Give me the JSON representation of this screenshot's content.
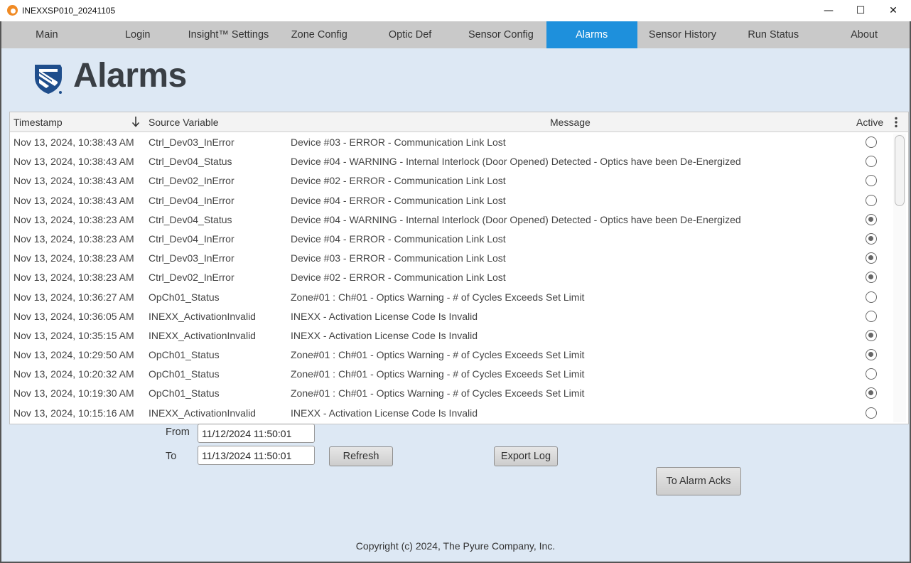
{
  "window": {
    "title": "INEXXSP010_20241105",
    "minimize": "—",
    "maximize": "☐",
    "close": "✕"
  },
  "tabs": [
    {
      "label": "Main"
    },
    {
      "label": "Login"
    },
    {
      "label": "Insight™ Settings"
    },
    {
      "label": "Zone Config"
    },
    {
      "label": "Optic Def"
    },
    {
      "label": "Sensor Config"
    },
    {
      "label": "Alarms",
      "active": true
    },
    {
      "label": "Sensor History"
    },
    {
      "label": "Run Status"
    },
    {
      "label": "About"
    }
  ],
  "page": {
    "title": "Alarms"
  },
  "table": {
    "columns": {
      "timestamp": "Timestamp",
      "source": "Source Variable",
      "message": "Message",
      "active": "Active"
    },
    "rows": [
      {
        "timestamp": "Nov 13, 2024, 10:38:43 AM",
        "source": "Ctrl_Dev03_InError",
        "message": "Device #03 - ERROR - Communication Link Lost",
        "active": false
      },
      {
        "timestamp": "Nov 13, 2024, 10:38:43 AM",
        "source": "Ctrl_Dev04_Status",
        "message": "Device #04 - WARNING - Internal Interlock (Door Opened) Detected - Optics have been De-Energized",
        "active": false
      },
      {
        "timestamp": "Nov 13, 2024, 10:38:43 AM",
        "source": "Ctrl_Dev02_InError",
        "message": "Device #02 - ERROR - Communication Link Lost",
        "active": false
      },
      {
        "timestamp": "Nov 13, 2024, 10:38:43 AM",
        "source": "Ctrl_Dev04_InError",
        "message": "Device #04 - ERROR - Communication Link Lost",
        "active": false
      },
      {
        "timestamp": "Nov 13, 2024, 10:38:23 AM",
        "source": "Ctrl_Dev04_Status",
        "message": "Device #04 - WARNING - Internal Interlock (Door Opened) Detected - Optics have been De-Energized",
        "active": true
      },
      {
        "timestamp": "Nov 13, 2024, 10:38:23 AM",
        "source": "Ctrl_Dev04_InError",
        "message": "Device #04 - ERROR - Communication Link Lost",
        "active": true
      },
      {
        "timestamp": "Nov 13, 2024, 10:38:23 AM",
        "source": "Ctrl_Dev03_InError",
        "message": "Device #03 - ERROR - Communication Link Lost",
        "active": true
      },
      {
        "timestamp": "Nov 13, 2024, 10:38:23 AM",
        "source": "Ctrl_Dev02_InError",
        "message": "Device #02 - ERROR - Communication Link Lost",
        "active": true
      },
      {
        "timestamp": "Nov 13, 2024, 10:36:27 AM",
        "source": "OpCh01_Status",
        "message": "Zone#01 : Ch#01 - Optics Warning - # of Cycles Exceeds Set Limit",
        "active": false
      },
      {
        "timestamp": "Nov 13, 2024, 10:36:05 AM",
        "source": "INEXX_ActivationInvalid",
        "message": "INEXX - Activation License Code Is Invalid",
        "active": false
      },
      {
        "timestamp": "Nov 13, 2024, 10:35:15 AM",
        "source": "INEXX_ActivationInvalid",
        "message": "INEXX - Activation License Code Is Invalid",
        "active": true
      },
      {
        "timestamp": "Nov 13, 2024, 10:29:50 AM",
        "source": "OpCh01_Status",
        "message": "Zone#01 : Ch#01 - Optics Warning - # of Cycles Exceeds Set Limit",
        "active": true
      },
      {
        "timestamp": "Nov 13, 2024, 10:20:32 AM",
        "source": "OpCh01_Status",
        "message": "Zone#01 : Ch#01 - Optics Warning - # of Cycles Exceeds Set Limit",
        "active": false
      },
      {
        "timestamp": "Nov 13, 2024, 10:19:30 AM",
        "source": "OpCh01_Status",
        "message": "Zone#01 : Ch#01 - Optics Warning - # of Cycles Exceeds Set Limit",
        "active": true
      },
      {
        "timestamp": "Nov 13, 2024, 10:15:16 AM",
        "source": "INEXX_ActivationInvalid",
        "message": "INEXX - Activation License Code Is Invalid",
        "active": false
      }
    ]
  },
  "filter": {
    "from_label": "From",
    "from_value": "11/12/2024 11:50:01",
    "to_label": "To",
    "to_value": "11/13/2024 11:50:01",
    "refresh_label": "Refresh",
    "export_label": "Export Log",
    "acks_label": "To Alarm Acks"
  },
  "footer": {
    "copyright": "Copyright (c) 2024, The Pyure Company, Inc."
  },
  "colors": {
    "active_tab": "#1e90dc",
    "background": "#dde8f4",
    "tabbar": "#c9c9c9"
  }
}
